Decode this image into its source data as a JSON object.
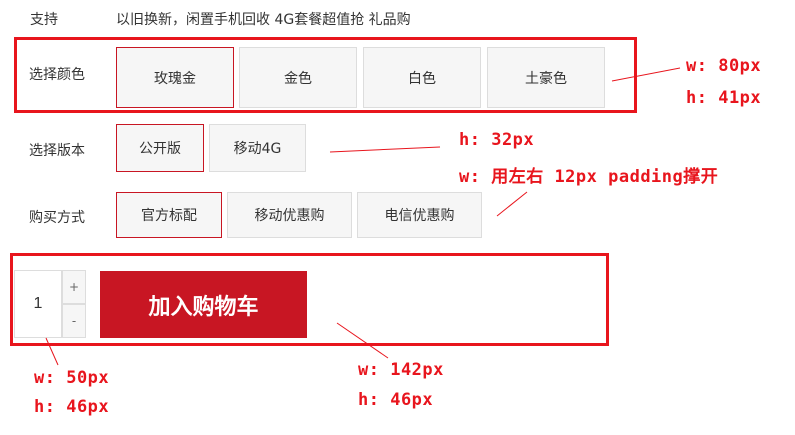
{
  "support": {
    "label": "支持",
    "text": "以旧换新，闲置手机回收 4G套餐超值抢 礼品购"
  },
  "color": {
    "label": "选择颜色",
    "options": [
      "玫瑰金",
      "金色",
      "白色",
      "土豪色"
    ],
    "selected": "玫瑰金"
  },
  "version": {
    "label": "选择版本",
    "options": [
      "公开版",
      "移动4G"
    ],
    "selected": "公开版"
  },
  "purchase": {
    "label": "购买方式",
    "options": [
      "官方标配",
      "移动优惠购",
      "电信优惠购"
    ],
    "selected": "官方标配"
  },
  "cart": {
    "quantity": "1",
    "increment_label": "+",
    "decrement_label": "-",
    "button_label": "加入购物车"
  },
  "annotations": {
    "color_w": "w: 80px",
    "color_h": "h: 41px",
    "version_h": "h: 32px",
    "version_w": "w: 用左右 12px padding撑开",
    "qty_w": "w: 50px",
    "qty_h": "h: 46px",
    "btn_w": "w: 142px",
    "btn_h": "h: 46px"
  },
  "colors": {
    "accent": "#c81623",
    "annotation": "#e8151d",
    "option_bg": "#f6f6f6",
    "option_border": "#dddddd"
  }
}
